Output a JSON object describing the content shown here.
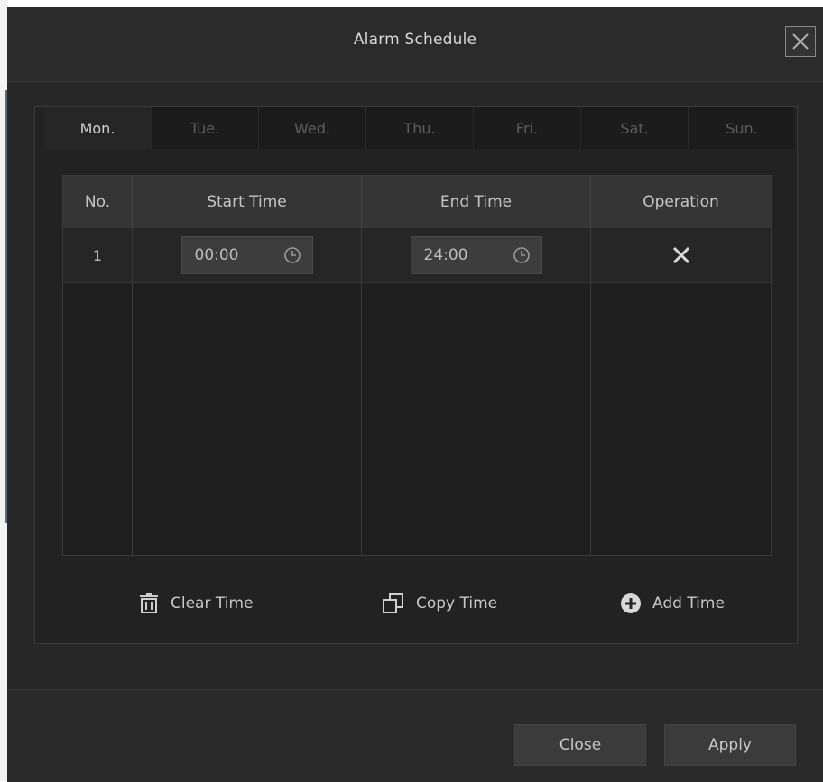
{
  "dialog": {
    "title": "Alarm Schedule"
  },
  "tabs": [
    {
      "label": "Mon.",
      "active": true
    },
    {
      "label": "Tue.",
      "active": false
    },
    {
      "label": "Wed.",
      "active": false
    },
    {
      "label": "Thu.",
      "active": false
    },
    {
      "label": "Fri.",
      "active": false
    },
    {
      "label": "Sat.",
      "active": false
    },
    {
      "label": "Sun.",
      "active": false
    }
  ],
  "table": {
    "headers": [
      "No.",
      "Start Time",
      "End Time",
      "Operation"
    ],
    "rows": [
      {
        "no": "1",
        "start": "00:00",
        "end": "24:00"
      }
    ]
  },
  "actions": {
    "clear": "Clear Time",
    "copy": "Copy Time",
    "add": "Add Time"
  },
  "footer": {
    "close": "Close",
    "apply": "Apply"
  },
  "icons": {
    "close": "close-icon",
    "clock": "clock-icon",
    "delete": "delete-icon",
    "trash": "trash-icon",
    "copy": "copy-icon",
    "add": "plus-circle-icon"
  }
}
